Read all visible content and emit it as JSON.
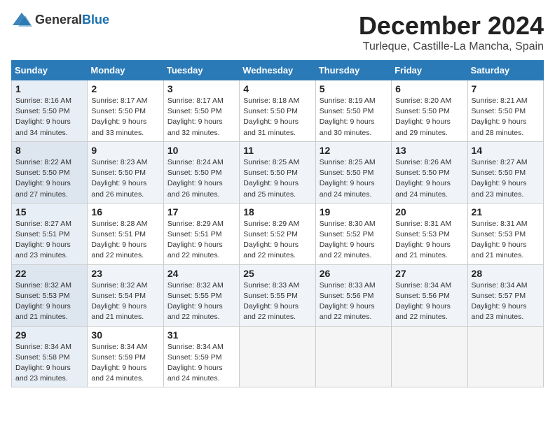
{
  "header": {
    "logo_general": "General",
    "logo_blue": "Blue",
    "title": "December 2024",
    "subtitle": "Turleque, Castille-La Mancha, Spain"
  },
  "calendar": {
    "weekdays": [
      "Sunday",
      "Monday",
      "Tuesday",
      "Wednesday",
      "Thursday",
      "Friday",
      "Saturday"
    ],
    "weeks": [
      [
        {
          "day": "1",
          "sunrise": "8:16 AM",
          "sunset": "5:50 PM",
          "daylight": "9 hours and 34 minutes."
        },
        {
          "day": "2",
          "sunrise": "8:17 AM",
          "sunset": "5:50 PM",
          "daylight": "9 hours and 33 minutes."
        },
        {
          "day": "3",
          "sunrise": "8:17 AM",
          "sunset": "5:50 PM",
          "daylight": "9 hours and 32 minutes."
        },
        {
          "day": "4",
          "sunrise": "8:18 AM",
          "sunset": "5:50 PM",
          "daylight": "9 hours and 31 minutes."
        },
        {
          "day": "5",
          "sunrise": "8:19 AM",
          "sunset": "5:50 PM",
          "daylight": "9 hours and 30 minutes."
        },
        {
          "day": "6",
          "sunrise": "8:20 AM",
          "sunset": "5:50 PM",
          "daylight": "9 hours and 29 minutes."
        },
        {
          "day": "7",
          "sunrise": "8:21 AM",
          "sunset": "5:50 PM",
          "daylight": "9 hours and 28 minutes."
        }
      ],
      [
        {
          "day": "8",
          "sunrise": "8:22 AM",
          "sunset": "5:50 PM",
          "daylight": "9 hours and 27 minutes."
        },
        {
          "day": "9",
          "sunrise": "8:23 AM",
          "sunset": "5:50 PM",
          "daylight": "9 hours and 26 minutes."
        },
        {
          "day": "10",
          "sunrise": "8:24 AM",
          "sunset": "5:50 PM",
          "daylight": "9 hours and 26 minutes."
        },
        {
          "day": "11",
          "sunrise": "8:25 AM",
          "sunset": "5:50 PM",
          "daylight": "9 hours and 25 minutes."
        },
        {
          "day": "12",
          "sunrise": "8:25 AM",
          "sunset": "5:50 PM",
          "daylight": "9 hours and 24 minutes."
        },
        {
          "day": "13",
          "sunrise": "8:26 AM",
          "sunset": "5:50 PM",
          "daylight": "9 hours and 24 minutes."
        },
        {
          "day": "14",
          "sunrise": "8:27 AM",
          "sunset": "5:50 PM",
          "daylight": "9 hours and 23 minutes."
        }
      ],
      [
        {
          "day": "15",
          "sunrise": "8:27 AM",
          "sunset": "5:51 PM",
          "daylight": "9 hours and 23 minutes."
        },
        {
          "day": "16",
          "sunrise": "8:28 AM",
          "sunset": "5:51 PM",
          "daylight": "9 hours and 22 minutes."
        },
        {
          "day": "17",
          "sunrise": "8:29 AM",
          "sunset": "5:51 PM",
          "daylight": "9 hours and 22 minutes."
        },
        {
          "day": "18",
          "sunrise": "8:29 AM",
          "sunset": "5:52 PM",
          "daylight": "9 hours and 22 minutes."
        },
        {
          "day": "19",
          "sunrise": "8:30 AM",
          "sunset": "5:52 PM",
          "daylight": "9 hours and 22 minutes."
        },
        {
          "day": "20",
          "sunrise": "8:31 AM",
          "sunset": "5:53 PM",
          "daylight": "9 hours and 21 minutes."
        },
        {
          "day": "21",
          "sunrise": "8:31 AM",
          "sunset": "5:53 PM",
          "daylight": "9 hours and 21 minutes."
        }
      ],
      [
        {
          "day": "22",
          "sunrise": "8:32 AM",
          "sunset": "5:53 PM",
          "daylight": "9 hours and 21 minutes."
        },
        {
          "day": "23",
          "sunrise": "8:32 AM",
          "sunset": "5:54 PM",
          "daylight": "9 hours and 21 minutes."
        },
        {
          "day": "24",
          "sunrise": "8:32 AM",
          "sunset": "5:55 PM",
          "daylight": "9 hours and 22 minutes."
        },
        {
          "day": "25",
          "sunrise": "8:33 AM",
          "sunset": "5:55 PM",
          "daylight": "9 hours and 22 minutes."
        },
        {
          "day": "26",
          "sunrise": "8:33 AM",
          "sunset": "5:56 PM",
          "daylight": "9 hours and 22 minutes."
        },
        {
          "day": "27",
          "sunrise": "8:34 AM",
          "sunset": "5:56 PM",
          "daylight": "9 hours and 22 minutes."
        },
        {
          "day": "28",
          "sunrise": "8:34 AM",
          "sunset": "5:57 PM",
          "daylight": "9 hours and 23 minutes."
        }
      ],
      [
        {
          "day": "29",
          "sunrise": "8:34 AM",
          "sunset": "5:58 PM",
          "daylight": "9 hours and 23 minutes."
        },
        {
          "day": "30",
          "sunrise": "8:34 AM",
          "sunset": "5:59 PM",
          "daylight": "9 hours and 24 minutes."
        },
        {
          "day": "31",
          "sunrise": "8:34 AM",
          "sunset": "5:59 PM",
          "daylight": "9 hours and 24 minutes."
        },
        null,
        null,
        null,
        null
      ]
    ]
  }
}
